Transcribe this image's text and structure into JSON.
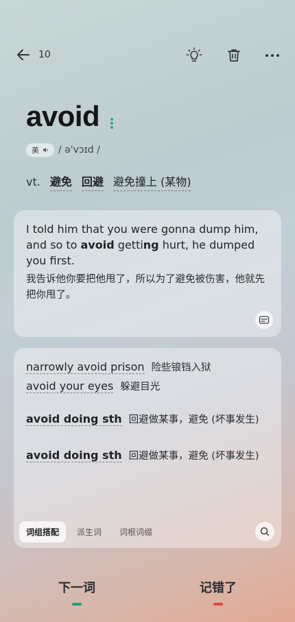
{
  "header": {
    "count": "10",
    "icons": [
      "back-arrow-icon",
      "lightbulb-icon",
      "trash-icon",
      "more-icon"
    ]
  },
  "word": {
    "text": "avoid",
    "accent_label": "美",
    "phonetic": "/ ə'vɔɪd /"
  },
  "definitions": {
    "pos": "vt.",
    "items": [
      "避免",
      "回避",
      "避免撞上 (某物)"
    ]
  },
  "example": {
    "en_before": "I told him that you were gonna dump him, and so to ",
    "en_keyword": "avoid",
    "en_mid": " getti",
    "en_bold2": "ng",
    "en_after": " hurt, he dumped you first.",
    "zh": "我告诉他你要把他甩了，所以为了避免被伤害，他就先把你甩了。"
  },
  "phrases": [
    {
      "en": "narrowly avoid prison",
      "zh": "险些锒铛入狱"
    },
    {
      "en": "avoid your eyes",
      "zh": "躲避目光"
    },
    {
      "en": "avoid doing sth",
      "zh": "回避做某事，避免 (坏事发生)"
    },
    {
      "en": "avoid doing sth",
      "zh": "回避做某事，避免 (坏事发生)"
    }
  ],
  "tabs": [
    "词组搭配",
    "派生词",
    "词根词缀"
  ],
  "bottom": {
    "next": "下一词",
    "wrong": "记错了"
  },
  "colors": {
    "green": "#1e9e78",
    "red": "#e0483e",
    "dot": "#2faa78"
  }
}
